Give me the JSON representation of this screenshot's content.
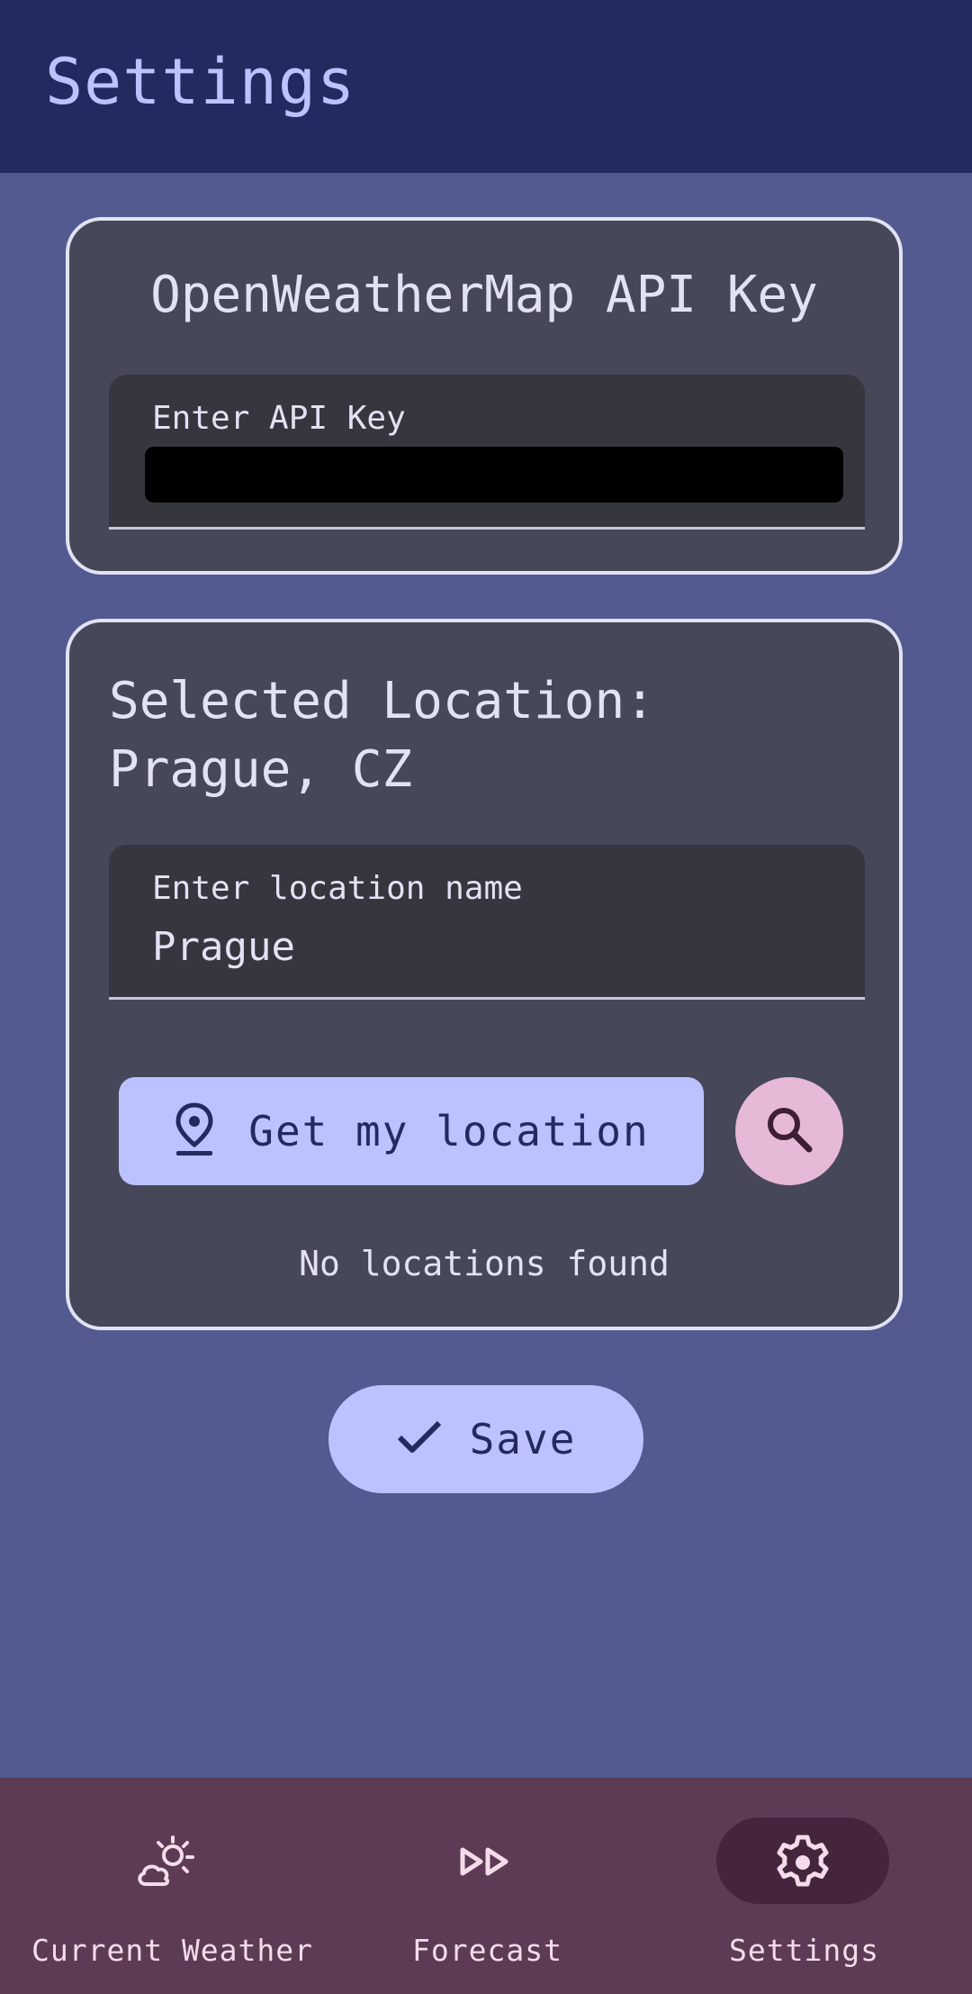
{
  "app_bar": {
    "title": "Settings"
  },
  "api_card": {
    "title": "OpenWeatherMap API Key",
    "field_label": "Enter API Key"
  },
  "location_card": {
    "title_line1": "Selected Location:",
    "title_line2": "Prague, CZ",
    "field_label": "Enter location name",
    "field_value": "Prague",
    "get_location_label": "Get my location",
    "empty_message": "No locations found"
  },
  "save_button": {
    "label": "Save"
  },
  "nav": {
    "items": [
      {
        "label": "Current Weather",
        "icon": "partly-cloudy-icon",
        "active": false
      },
      {
        "label": "Forecast",
        "icon": "fast-forward-icon",
        "active": false
      },
      {
        "label": "Settings",
        "icon": "gear-icon",
        "active": true
      }
    ]
  },
  "colors": {
    "background": "#525a90",
    "app_bar": "#232a60",
    "card": "#464759",
    "primary_button": "#bcc2ff",
    "search_button": "#e6b9d6",
    "nav_bar": "#5d3b55",
    "nav_active_indicator": "#45253d"
  }
}
